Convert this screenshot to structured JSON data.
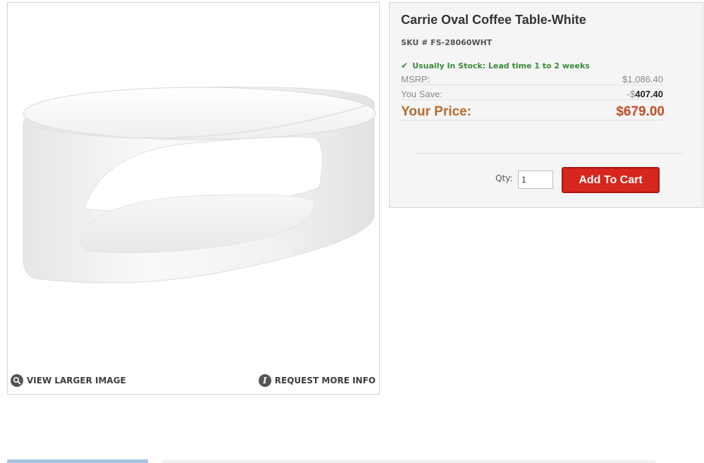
{
  "product": {
    "title": "Carrie Oval Coffee Table-White",
    "sku": "SKU # FS-28060WHT",
    "stock_status": "Usually In Stock: Lead time 1 to 2 weeks"
  },
  "pricing": {
    "msrp_label": "MSRP:",
    "msrp_value": "$1,086.40",
    "save_label": "You Save:",
    "save_prefix": "-$",
    "save_value": "407.40",
    "your_price_label": "Your Price:",
    "your_price_value": "$679.00"
  },
  "cart": {
    "qty_label": "Qty:",
    "qty_value": "1",
    "add_button": "Add To Cart"
  },
  "image_links": {
    "view_larger": "VIEW LARGER IMAGE",
    "request_info": "REQUEST MORE INFO"
  },
  "icons": {
    "view_larger": "magnifier-icon",
    "request_info": "info-icon",
    "stock": "check-icon"
  },
  "colors": {
    "stock_green": "#3a8a3a",
    "price_orange": "#b86a2a",
    "price_red": "#c24c24",
    "cart_button": "#d6261e"
  }
}
